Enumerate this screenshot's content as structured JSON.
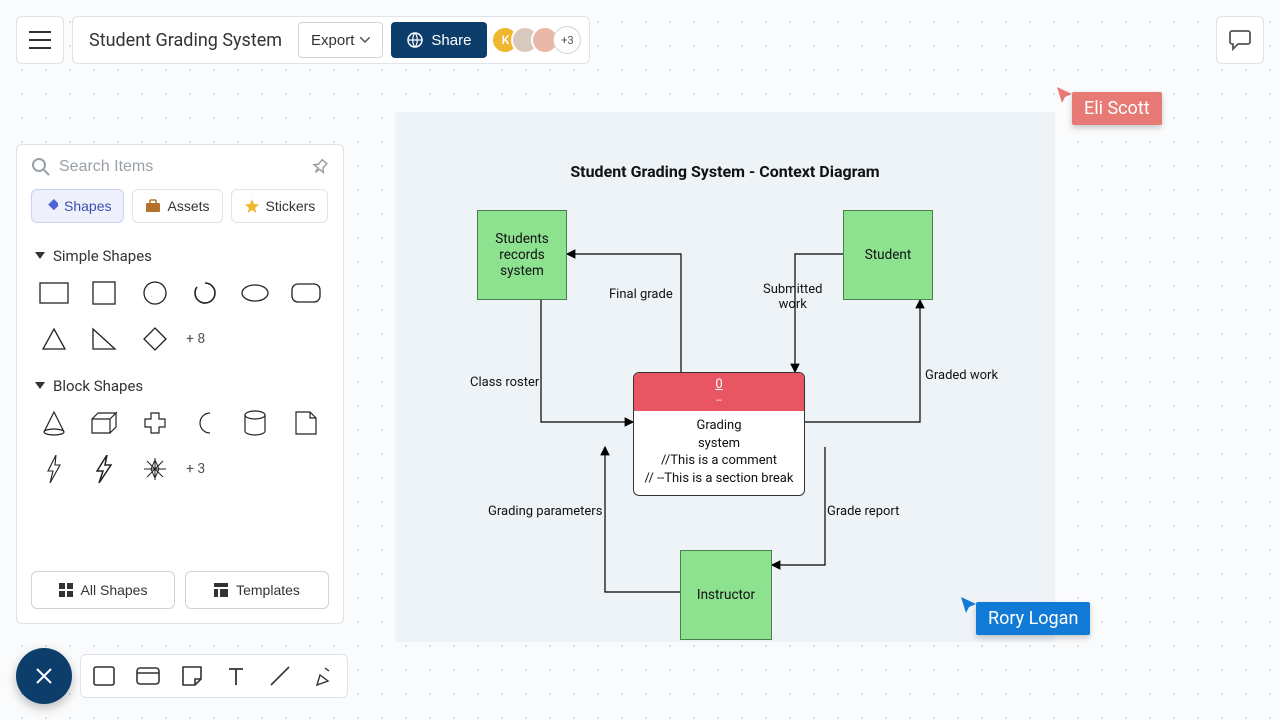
{
  "header": {
    "title": "Student Grading System",
    "export_label": "Export",
    "share_label": "Share",
    "avatar_more": "+3"
  },
  "search": {
    "placeholder": "Search Items"
  },
  "tabs": {
    "shapes": "Shapes",
    "assets": "Assets",
    "stickers": "Stickers"
  },
  "sections": {
    "simple": {
      "label": "Simple Shapes",
      "more": "+ 8"
    },
    "block": {
      "label": "Block Shapes",
      "more": "+ 3"
    }
  },
  "panel_footer": {
    "all_shapes": "All Shapes",
    "templates": "Templates"
  },
  "diagram": {
    "title": "Student Grading System - Context Diagram",
    "nodes": {
      "records": "Students\nrecords\nsystem",
      "student": "Student",
      "instructor": "Instructor"
    },
    "center": {
      "head_num": "0",
      "head_sub": "--",
      "lines": [
        "Grading",
        "system",
        "//This is a comment",
        "// --This is a section break"
      ]
    },
    "edges": {
      "final_grade": "Final grade",
      "class_roster": "Class roster",
      "submitted_work": "Submitted\nwork",
      "graded_work": "Graded work",
      "grading_params": "Grading parameters",
      "grade_report": "Grade report"
    }
  },
  "cursors": {
    "eli": {
      "name": "Eli Scott",
      "color": "#e77a74"
    },
    "rory": {
      "name": "Rory Logan",
      "color": "#1179d6"
    }
  }
}
